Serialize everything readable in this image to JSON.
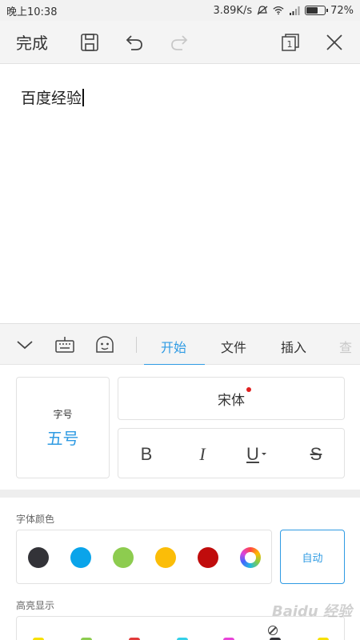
{
  "status_bar": {
    "time": "晚上10:38",
    "network_speed": "3.89K/s",
    "battery_percent": "72%",
    "battery_level": 0.72,
    "icons": [
      "mute-icon",
      "wifi-icon",
      "signal-icon",
      "battery-icon"
    ]
  },
  "toolbar": {
    "done_label": "完成",
    "icons": [
      "save-icon",
      "undo-icon",
      "redo-icon",
      "page-view-icon",
      "close-icon"
    ]
  },
  "document": {
    "text": "百度经验"
  },
  "panel": {
    "icons": [
      "collapse-icon",
      "keyboard-icon",
      "emoji-icon"
    ],
    "tabs": [
      "开始",
      "文件",
      "插入",
      "查"
    ],
    "active_tab": "开始"
  },
  "font": {
    "size_label": "字号",
    "size_value": "五号",
    "font_name": "宋体",
    "style_buttons": [
      "B",
      "I",
      "U",
      "S"
    ]
  },
  "font_color": {
    "label": "字体颜色",
    "swatches": [
      "#333338",
      "#0aa4ea",
      "#8dcc4f",
      "#fbbd08",
      "#c00c0c",
      "rainbow"
    ],
    "auto_label": "自动"
  },
  "highlight": {
    "label": "高亮显示",
    "swatches": [
      "#f7e000",
      "#8dcc4f",
      "#e23a3a",
      "#34d0e8",
      "#e844d8",
      "#333338",
      "#f7e000"
    ]
  },
  "watermark": "Baidu 经验",
  "colors": {
    "accent": "#2f9be3",
    "toolbar_bg": "#f4f4f4"
  }
}
